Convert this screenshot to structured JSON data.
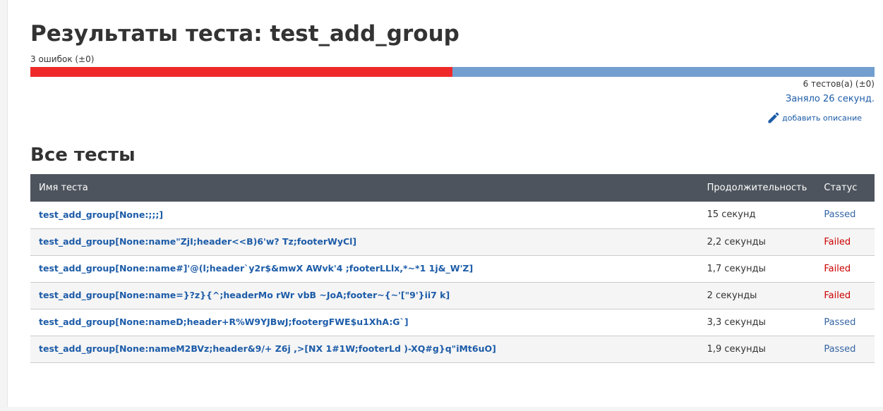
{
  "header": {
    "title": "Результаты теста: test_add_group",
    "fail_summary": "3 ошибок (±0)",
    "fail_fraction": 0.5,
    "test_count": "6 тестов(а) (±0)",
    "duration": "Заняло 26 секунд.",
    "add_description": "добавить описание"
  },
  "colors": {
    "fail": "#ef2929",
    "pass": "#729fcf",
    "link": "#1d5ca8",
    "table_header": "#4d545d"
  },
  "section_title": "Все тесты",
  "table": {
    "columns": {
      "name": "Имя теста",
      "duration": "Продолжительность",
      "status": "Статус"
    },
    "rows": [
      {
        "name": "test_add_group[None:;;;]",
        "duration": "15 секунд",
        "status": "Passed"
      },
      {
        "name": "test_add_group[None:name\"ZjI;header<<B)6'w? Tz;footerWyCl]",
        "duration": "2,2 секунды",
        "status": "Failed"
      },
      {
        "name": "test_add_group[None:name#]'@(l;header`y2r$&mwX AWvk'4 ;footerLLlx,*~*1 1j&_W'Z]",
        "duration": "1,7 секунды",
        "status": "Failed"
      },
      {
        "name": "test_add_group[None:name=}?z}{^;headerMo rWr vbB ~JoA;footer~{~'[\"9'}ii7 k]",
        "duration": "2 секунды",
        "status": "Failed"
      },
      {
        "name": "test_add_group[None:nameD;header+R%W9YJBwJ;footergFWE$u1XhA:G`]",
        "duration": "3,3 секунды",
        "status": "Passed"
      },
      {
        "name": "test_add_group[None:nameM2BVz;header&9/+ Z6j ,>[NX 1#1W;footerLd )-XQ#g}q\"iMt6uO]",
        "duration": "1,9 секунды",
        "status": "Passed"
      }
    ]
  }
}
